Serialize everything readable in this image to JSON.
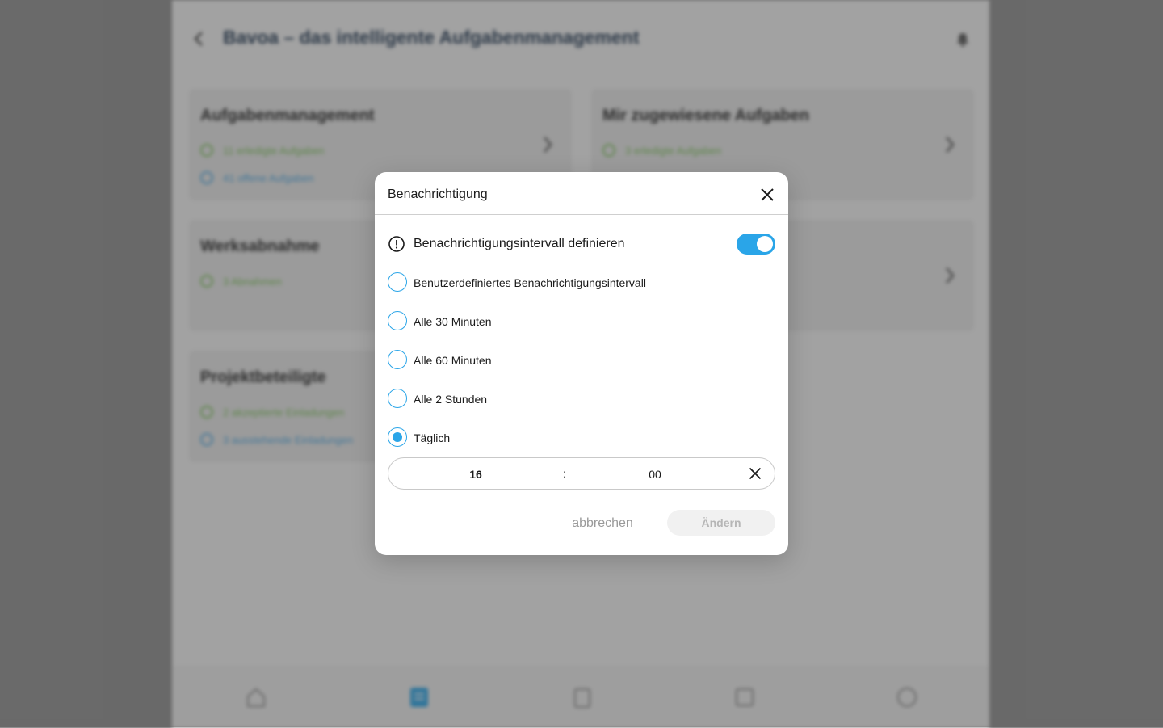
{
  "background": {
    "app_title": "Bavoa – das intelligente Aufgabenmanagement",
    "cards": [
      {
        "title": "Aufgabenmanagement",
        "lines": [
          "11 erledigte Aufgaben",
          "41 offene Aufgaben"
        ]
      },
      {
        "title": "Mir zugewiesene Aufgaben",
        "lines": [
          "3 erledigte Aufgaben"
        ]
      },
      {
        "title": "Werksabnahme",
        "lines": [
          "3 Abnahmen"
        ]
      },
      {
        "title": "Projektbeteiligte",
        "lines": [
          "2 akzeptierte Einladungen",
          "3 ausstehende Einladungen"
        ]
      }
    ],
    "nav_icons": [
      "home-icon",
      "tasks-icon",
      "clipboard-icon",
      "document-icon",
      "info-icon"
    ]
  },
  "dialog": {
    "title": "Benachrichtigung",
    "define_label": "Benachrichtigungsintervall definieren",
    "toggle_on": true,
    "options": [
      {
        "label": "Benutzerdefiniertes Benachrichtigungsintervall",
        "checked": false
      },
      {
        "label": "Alle 30 Minuten",
        "checked": false
      },
      {
        "label": "Alle 60 Minuten",
        "checked": false
      },
      {
        "label": "Alle 2 Stunden",
        "checked": false
      },
      {
        "label": "Täglich",
        "checked": true
      }
    ],
    "time": {
      "hour": "16",
      "separator": ":",
      "minute": "00"
    },
    "cancel_label": "abbrechen",
    "change_label": "Ändern"
  },
  "colors": {
    "accent": "#2aa5e8",
    "green": "#7cc25a"
  }
}
